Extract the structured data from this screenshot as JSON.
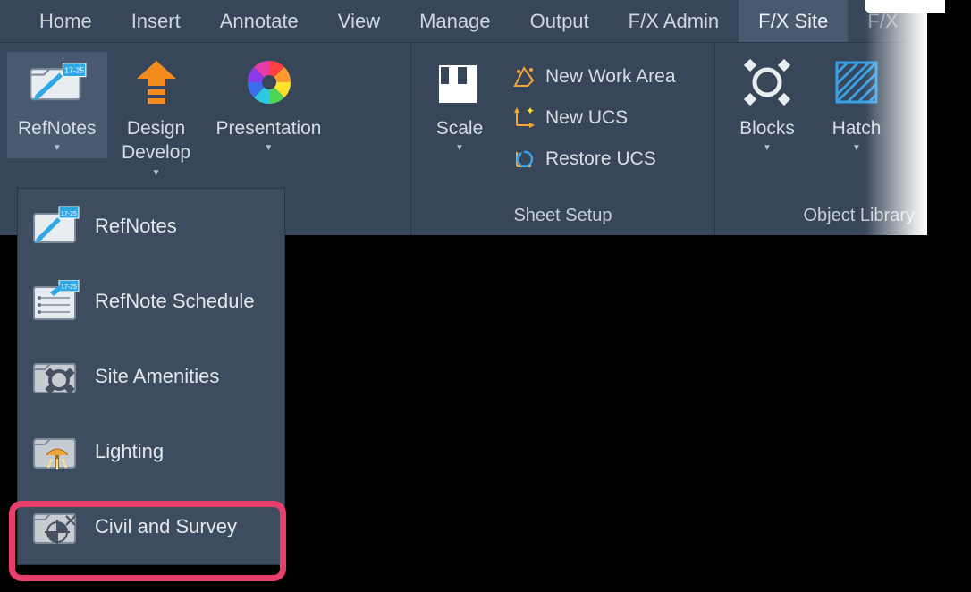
{
  "tabs": {
    "home": "Home",
    "insert": "Insert",
    "annotate": "Annotate",
    "view": "View",
    "manage": "Manage",
    "output": "Output",
    "fx_admin": "F/X Admin",
    "fx_site": "F/X Site",
    "fx_more": "F/X"
  },
  "ribbon": {
    "refnotes": "RefNotes",
    "design_develop_line1": "Design",
    "design_develop_line2": "Develop",
    "presentation": "Presentation",
    "scale": "Scale",
    "new_work_area": "New Work Area",
    "new_ucs": "New UCS",
    "restore_ucs": "Restore UCS",
    "sheet_setup_group": "Sheet Setup",
    "blocks": "Blocks",
    "hatch": "Hatch",
    "object_library_group": "Object Library"
  },
  "dropdown": {
    "refnotes": "RefNotes",
    "refnote_schedule": "RefNote Schedule",
    "site_amenities": "Site  Amenities",
    "lighting": "Lighting",
    "civil_survey": "Civil and Survey"
  }
}
